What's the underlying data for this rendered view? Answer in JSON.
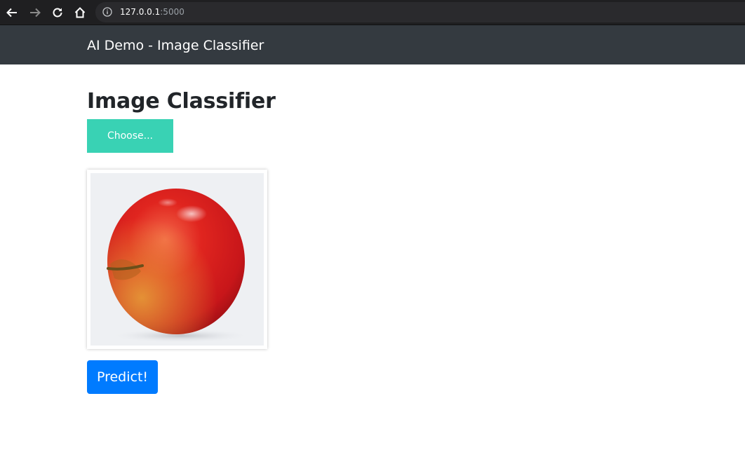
{
  "browser": {
    "url_host": "127.0.0.1",
    "url_port": ":5000",
    "icons": [
      "back-arrow-icon",
      "forward-arrow-icon",
      "reload-icon",
      "home-icon",
      "info-icon"
    ]
  },
  "navbar": {
    "brand": "AI Demo - Image Classifier",
    "background": "#343a40"
  },
  "main": {
    "title": "Image Classifier",
    "choose_label": "Choose...",
    "choose_color": "#39d2b4",
    "preview_subject": "red apple",
    "predict_label": "Predict!",
    "predict_color": "#007bff"
  }
}
